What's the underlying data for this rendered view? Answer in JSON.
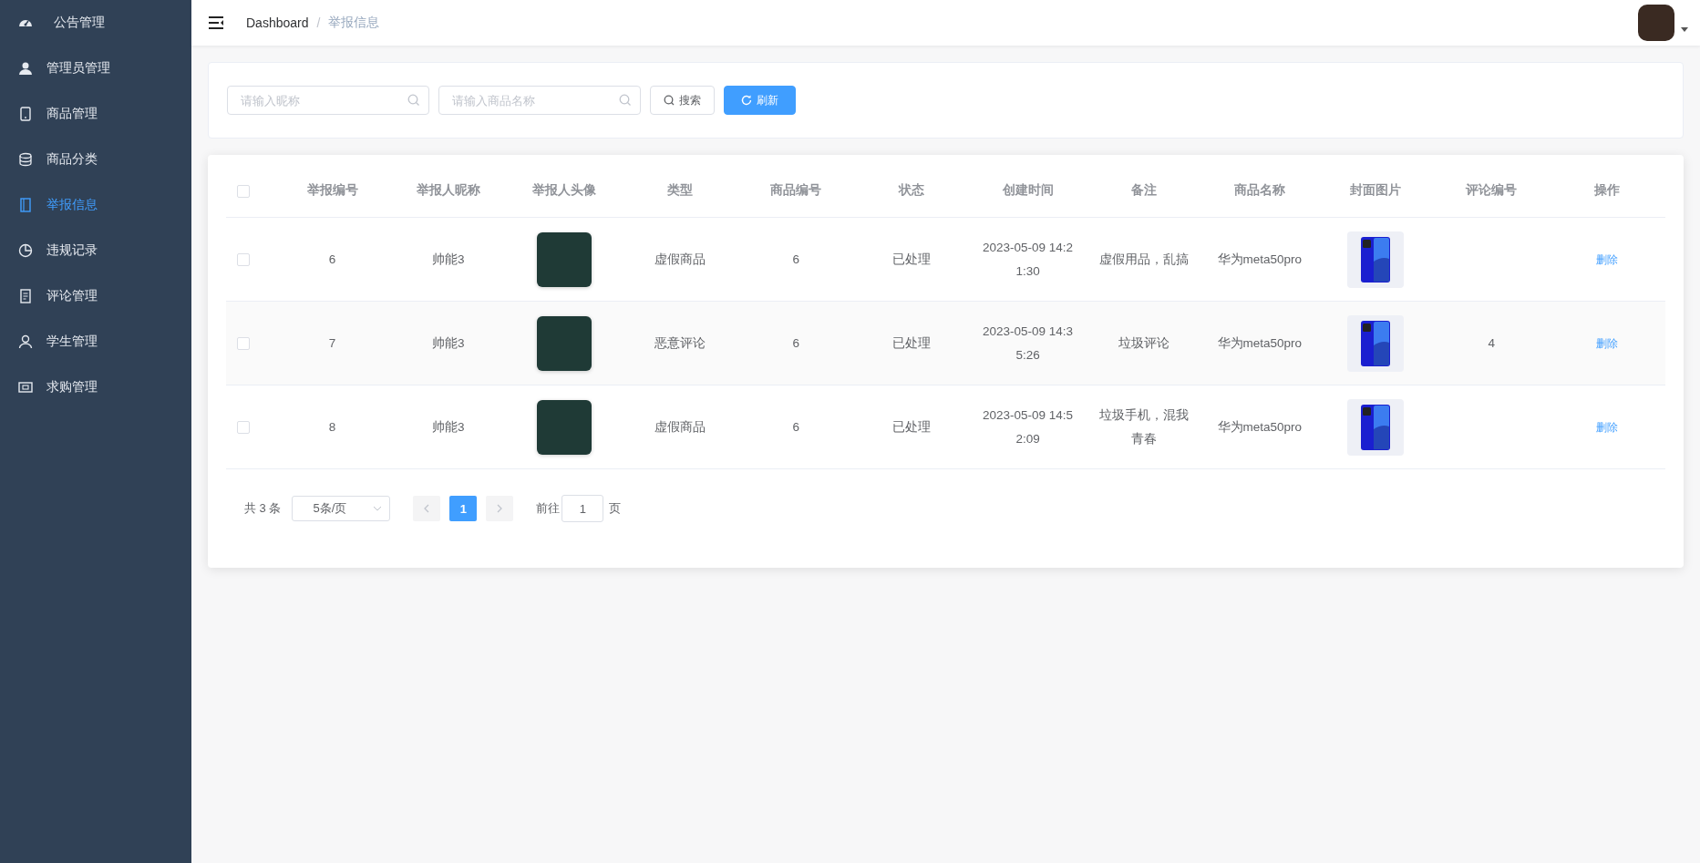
{
  "sidebar": {
    "items": [
      {
        "label": "公告管理",
        "selected": false
      },
      {
        "label": "管理员管理",
        "selected": false
      },
      {
        "label": "商品管理",
        "selected": false
      },
      {
        "label": "商品分类",
        "selected": false
      },
      {
        "label": "举报信息",
        "selected": true
      },
      {
        "label": "违规记录",
        "selected": false
      },
      {
        "label": "评论管理",
        "selected": false
      },
      {
        "label": "学生管理",
        "selected": false
      },
      {
        "label": "求购管理",
        "selected": false
      }
    ]
  },
  "breadcrumb": {
    "items": [
      "Dashboard",
      "举报信息"
    ],
    "separator": "/"
  },
  "filters": {
    "fields": [
      {
        "placeholder": "请输入昵称"
      },
      {
        "placeholder": "请输入商品名称"
      }
    ],
    "buttons": [
      {
        "label": "搜索",
        "kind": "search"
      },
      {
        "label": "刷新",
        "kind": "refresh"
      }
    ]
  },
  "table": {
    "header_checked": false,
    "columns": [
      "举报编号",
      "举报人昵称",
      "举报人头像",
      "类型",
      "商品编号",
      "状态",
      "创建时间",
      "备注",
      "商品名称",
      "封面图片",
      "评论编号",
      "操作"
    ],
    "rows": [
      {
        "checked": false,
        "id": "6",
        "nickname": "帅能3",
        "type": "虚假商品",
        "product_id": "6",
        "status": "已处理",
        "created": "2023-05-09 14:21:30",
        "remark": "虚假用品，乱搞",
        "product_name": "华为meta50pro",
        "comment_id": "",
        "action": "删除"
      },
      {
        "checked": false,
        "id": "7",
        "nickname": "帅能3",
        "type": "恶意评论",
        "product_id": "6",
        "status": "已处理",
        "created": "2023-05-09 14:35:26",
        "remark": "垃圾评论",
        "product_name": "华为meta50pro",
        "comment_id": "4",
        "action": "删除"
      },
      {
        "checked": false,
        "id": "8",
        "nickname": "帅能3",
        "type": "虚假商品",
        "product_id": "6",
        "status": "已处理",
        "created": "2023-05-09 14:52:09",
        "remark": "垃圾手机，混我青春",
        "product_name": "华为meta50pro",
        "comment_id": "",
        "action": "删除"
      }
    ]
  },
  "pagination": {
    "total": "共 3 条",
    "page_size": "5条/页",
    "pages": [
      {
        "label": "1",
        "selected": true
      }
    ],
    "goto_label": "前往",
    "goto_value": "1",
    "page_suffix": "页"
  }
}
